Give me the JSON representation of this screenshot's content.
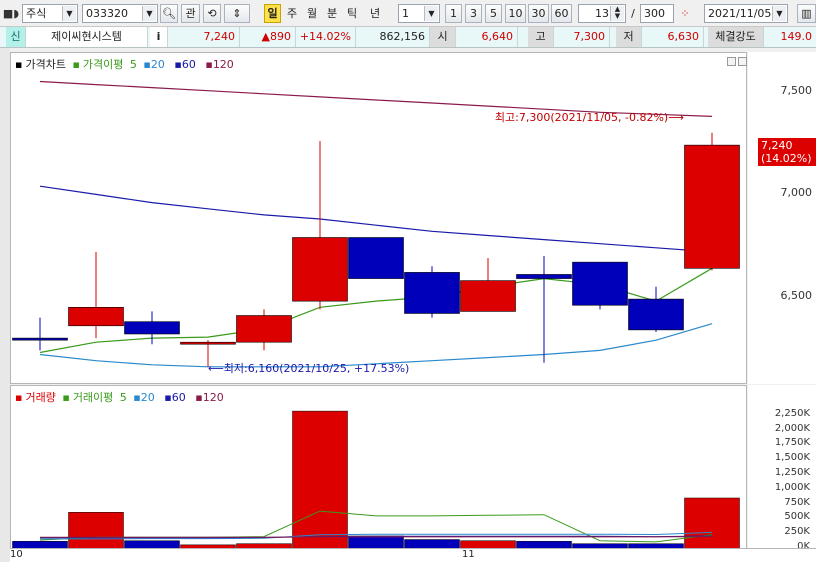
{
  "toolbar": {
    "market": "주식",
    "code": "033320",
    "gwan_label": "관",
    "period_buttons": [
      "일",
      "주",
      "월",
      "분",
      "틱",
      "년"
    ],
    "interval_value": "1",
    "interval_buttons": [
      "1",
      "3",
      "5",
      "10",
      "30",
      "60"
    ],
    "count_value": "13",
    "total_value": "300",
    "date_value": "2021/11/05"
  },
  "info": {
    "sin_label": "신",
    "stock_name": "제이씨현시스템",
    "info_button": "i",
    "price": "7,240",
    "change": "▲890",
    "change_pct": "+14.02%",
    "volume": "862,156",
    "open_label": "시",
    "open": "6,640",
    "high_label": "고",
    "high": "7,300",
    "low_label": "저",
    "low": "6,630",
    "strength_label": "체결강도",
    "strength": "149.0"
  },
  "price_panel": {
    "legend_main": "가격차트",
    "legend_ma": "가격이평",
    "legend_periods": [
      "5",
      "20",
      "60",
      "120"
    ],
    "y_ticks": [
      "7,500",
      "7,000",
      "6,500"
    ],
    "current_label": "7,240",
    "current_pct": "(14.02%)",
    "high_annotation": "최고:7,300(2021/11/05, -0.82%)⟶",
    "low_annotation": "⟵최저:6,160(2021/10/25, +17.53%)"
  },
  "volume_panel": {
    "legend_main": "거래량",
    "legend_ma": "거래이평",
    "legend_periods": [
      "5",
      "20",
      "60",
      "120"
    ],
    "y_ticks": [
      "2,250K",
      "2,000K",
      "1,750K",
      "1,500K",
      "1,250K",
      "1,000K",
      "750K",
      "500K",
      "250K",
      "0K"
    ],
    "x_labels": [
      "10",
      "11"
    ]
  },
  "colors": {
    "up": "#dd0000",
    "down": "#0000bb",
    "ma5": "#3a9a1a",
    "ma20": "#2a88cc",
    "ma60": "#1a1aaa",
    "ma120": "#8a1a4a"
  },
  "chart_data": {
    "type": "candlestick",
    "ylim": [
      6130,
      7640
    ],
    "candles": [
      {
        "o": 6300,
        "h": 6400,
        "l": 6240,
        "c": 6290
      },
      {
        "o": 6360,
        "h": 6720,
        "l": 6300,
        "c": 6450
      },
      {
        "o": 6380,
        "h": 6430,
        "l": 6270,
        "c": 6320
      },
      {
        "o": 6280,
        "h": 6290,
        "l": 6160,
        "c": 6280
      },
      {
        "o": 6280,
        "h": 6440,
        "l": 6240,
        "c": 6410
      },
      {
        "o": 6480,
        "h": 7260,
        "l": 6440,
        "c": 6790
      },
      {
        "o": 6790,
        "h": 6790,
        "l": 6590,
        "c": 6590
      },
      {
        "o": 6620,
        "h": 6650,
        "l": 6400,
        "c": 6420
      },
      {
        "o": 6430,
        "h": 6690,
        "l": 6430,
        "c": 6580
      },
      {
        "o": 6610,
        "h": 6700,
        "l": 6180,
        "c": 6590
      },
      {
        "o": 6670,
        "h": 6670,
        "l": 6440,
        "c": 6460
      },
      {
        "o": 6490,
        "h": 6550,
        "l": 6330,
        "c": 6340
      },
      {
        "o": 6640,
        "h": 7300,
        "l": 6630,
        "c": 7240
      }
    ],
    "price_ma": [
      {
        "period": "5",
        "values": [
          6230,
          6280,
          6300,
          6305,
          6345,
          6450,
          6480,
          6500,
          6550,
          6590,
          6560,
          6480,
          6640
        ]
      },
      {
        "period": "20",
        "values": [
          6220,
          6190,
          6170,
          6160,
          6160,
          6160,
          6175,
          6190,
          6205,
          6220,
          6240,
          6290,
          6370
        ]
      },
      {
        "period": "60",
        "values": [
          7040,
          7000,
          6960,
          6930,
          6900,
          6880,
          6850,
          6820,
          6800,
          6780,
          6760,
          6740,
          6720
        ]
      },
      {
        "period": "120",
        "values": [
          7550,
          7535,
          7520,
          7505,
          7490,
          7475,
          7460,
          7445,
          7430,
          7415,
          7400,
          7390,
          7380
        ]
      }
    ],
    "volumes": [
      130,
      620,
      140,
      70,
      90,
      2330,
      220,
      160,
      140,
      130,
      90,
      90,
      862
    ],
    "volume_ma": [
      {
        "period": "5",
        "values": [
          150,
          200,
          200,
          200,
          210,
          640,
          560,
          560,
          570,
          580,
          140,
          120,
          240
        ]
      },
      {
        "period": "20",
        "values": [
          170,
          170,
          175,
          175,
          180,
          240,
          250,
          250,
          250,
          250,
          250,
          245,
          280
        ]
      },
      {
        "period": "60",
        "values": [
          190,
          190,
          190,
          190,
          195,
          210,
          215,
          215,
          215,
          215,
          215,
          210,
          220
        ]
      },
      {
        "period": "120",
        "values": [
          200,
          200,
          200,
          200,
          200,
          205,
          205,
          205,
          205,
          205,
          205,
          205,
          210
        ]
      }
    ],
    "volume_ylim": [
      0,
      2450
    ]
  }
}
